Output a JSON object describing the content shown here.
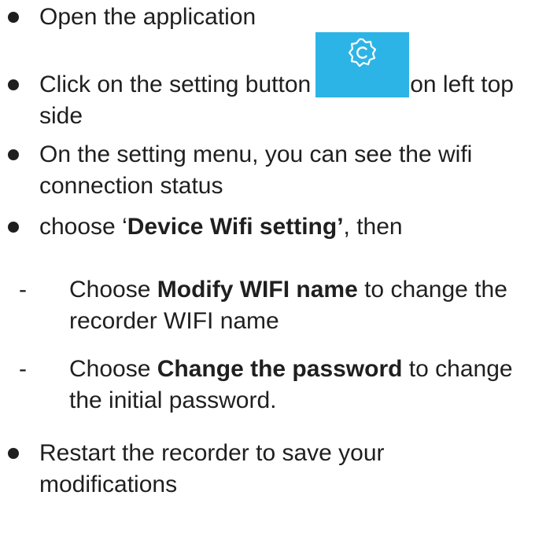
{
  "steps": [
    {
      "text": "Open the application"
    },
    {
      "before": "Click on the setting button",
      "after": "on left top",
      "line2": "side",
      "icon": "settings-gear-c-icon",
      "icon_bg": "#2db4e6"
    },
    {
      "line1": "On the setting menu, you can see the wifi",
      "line2": "connection status"
    },
    {
      "prefix": "choose ‘",
      "bold": "Device Wifi setting’",
      "suffix": ", then"
    },
    {
      "dash": "-",
      "prefix": "Choose ",
      "bold": "Modify WIFI name",
      "suffix": " to change the",
      "line2": "recorder WIFI name"
    },
    {
      "dash": "-",
      "prefix": "Choose ",
      "bold": "Change the password",
      "suffix": " to change",
      "line2": "the initial password."
    },
    {
      "line1": "Restart the recorder to save your",
      "line2": "modifications"
    }
  ]
}
